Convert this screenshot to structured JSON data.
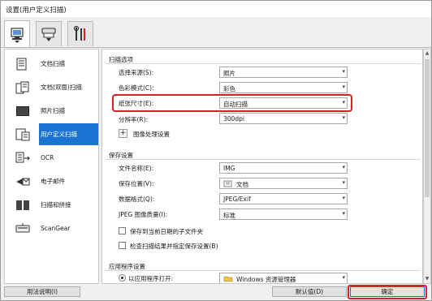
{
  "window": {
    "title": "设置(用户定义扫描)"
  },
  "tabs": [
    {
      "icon": "scan-from-computer-icon",
      "active": true
    },
    {
      "icon": "scan-from-panel-icon",
      "active": false
    },
    {
      "icon": "general-settings-tools-icon",
      "active": false
    }
  ],
  "sidebar": {
    "items": [
      {
        "label": "文档扫描",
        "icon": "document-scan-icon"
      },
      {
        "label": "文档(双面)扫描",
        "icon": "duplex-document-scan-icon"
      },
      {
        "label": "照片扫描",
        "icon": "photo-scan-icon"
      },
      {
        "label": "用户定义扫描",
        "icon": "custom-scan-icon",
        "selected": true
      },
      {
        "label": "OCR",
        "icon": "ocr-icon"
      },
      {
        "label": "电子邮件",
        "icon": "email-icon"
      },
      {
        "label": "扫描和拼接",
        "icon": "scan-stitch-icon"
      },
      {
        "label": "ScanGear",
        "icon": "scangear-icon"
      }
    ]
  },
  "scan_options": {
    "title": "扫描选项",
    "select_source_label": "选择来源(S):",
    "select_source_value": "照片",
    "color_mode_label": "色彩模式(C):",
    "color_mode_value": "彩色",
    "paper_size_label": "纸张尺寸(E):",
    "paper_size_value": "自动扫描",
    "resolution_label": "分辨率(R):",
    "resolution_value": "300dpi",
    "image_processing_label": "图像处理设置"
  },
  "save_settings": {
    "title": "保存设置",
    "file_name_label": "文件名称(E):",
    "file_name_value": "IMG",
    "save_in_label": "保存位置(V):",
    "save_in_value": "文档",
    "data_format_label": "数据格式(Q):",
    "data_format_value": "JPEG/Exif",
    "jpeg_quality_label": "JPEG 图像质量(I):",
    "jpeg_quality_value": "标准",
    "subfolder_label": "保存到当前日期的子文件夹",
    "check_results_label": "检查扫描结果并指定保存设置(B)"
  },
  "app_settings": {
    "title": "应用程序设置",
    "open_with_label": "以应用程序打开:",
    "open_with_value": "Windows 资源管理器"
  },
  "footer": {
    "instructions_label": "用法说明(I)",
    "defaults_label": "默认值(D)",
    "ok_label": "确定"
  },
  "colors": {
    "selection": "#1a73d2",
    "highlight_callout": "#d81e28"
  }
}
